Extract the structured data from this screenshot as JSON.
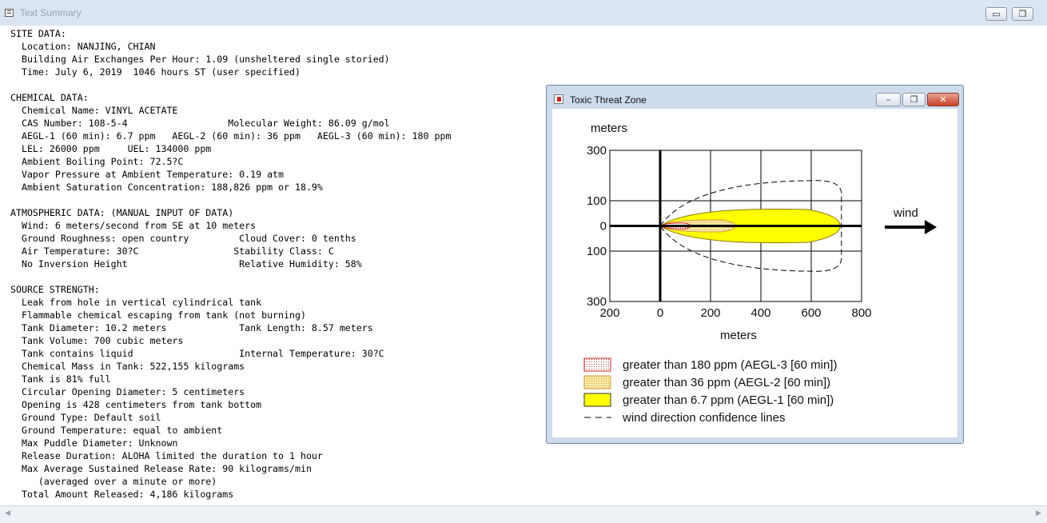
{
  "main_window": {
    "title": "Text Summary",
    "buttons": {
      "minimize": "▭",
      "restore": "❐"
    }
  },
  "summary_lines": [
    "SITE DATA:",
    "  Location: NANJING, CHIAN",
    "  Building Air Exchanges Per Hour: 1.09 (unsheltered single storied)",
    "  Time: July 6, 2019  1046 hours ST (user specified)",
    "",
    "CHEMICAL DATA:",
    "  Chemical Name: VINYL ACETATE",
    "  CAS Number: 108-5-4                  Molecular Weight: 86.09 g/mol",
    "  AEGL-1 (60 min): 6.7 ppm   AEGL-2 (60 min): 36 ppm   AEGL-3 (60 min): 180 ppm",
    "  LEL: 26000 ppm     UEL: 134000 ppm",
    "  Ambient Boiling Point: 72.5?C",
    "  Vapor Pressure at Ambient Temperature: 0.19 atm",
    "  Ambient Saturation Concentration: 188,826 ppm or 18.9%",
    "",
    "ATMOSPHERIC DATA: (MANUAL INPUT OF DATA)",
    "  Wind: 6 meters/second from SE at 10 meters",
    "  Ground Roughness: open country         Cloud Cover: 0 tenths",
    "  Air Temperature: 30?C                 Stability Class: C",
    "  No Inversion Height                    Relative Humidity: 58%",
    "",
    "SOURCE STRENGTH:",
    "  Leak from hole in vertical cylindrical tank",
    "  Flammable chemical escaping from tank (not burning)",
    "  Tank Diameter: 10.2 meters             Tank Length: 8.57 meters",
    "  Tank Volume: 700 cubic meters",
    "  Tank contains liquid                   Internal Temperature: 30?C",
    "  Chemical Mass in Tank: 522,155 kilograms",
    "  Tank is 81% full",
    "  Circular Opening Diameter: 5 centimeters",
    "  Opening is 428 centimeters from tank bottom",
    "  Ground Type: Default soil",
    "  Ground Temperature: equal to ambient",
    "  Max Puddle Diameter: Unknown",
    "  Release Duration: ALOHA limited the duration to 1 hour",
    "  Max Average Sustained Release Rate: 90 kilograms/min",
    "     (averaged over a minute or more)",
    "  Total Amount Released: 4,186 kilograms"
  ],
  "threat_window": {
    "title": "Toxic Threat Zone",
    "buttons": {
      "minimize": "–",
      "restore": "❐",
      "close": "✕"
    },
    "y_unit_label": "meters",
    "x_unit_label": "meters",
    "wind_label": "wind",
    "legend": [
      {
        "label": "greater than 180 ppm (AEGL-3 [60 min])",
        "color": "#ffffff",
        "pattern": "red-dots"
      },
      {
        "label": "greater than 36 ppm (AEGL-2 [60 min])",
        "color": "#f7e8a0",
        "pattern": "orange-dots"
      },
      {
        "label": "greater than 6.7 ppm (AEGL-1 [60 min])",
        "color": "#ffff00",
        "pattern": "solid"
      },
      {
        "label": "wind direction confidence lines",
        "color": "#000000",
        "pattern": "dashed"
      }
    ]
  },
  "chart_data": {
    "type": "area",
    "x_ticks": [
      "200",
      "0",
      "200",
      "400",
      "600",
      "800"
    ],
    "y_ticks": [
      "300",
      "100",
      "0",
      "100",
      "300"
    ],
    "xlim": [
      -200,
      800
    ],
    "ylim": [
      -300,
      300
    ],
    "grid": true,
    "zones": [
      {
        "name": "greater than 6.7 ppm (AEGL-1 [60 min])",
        "color": "#ffff00",
        "max_x": 715,
        "half_width": 70
      },
      {
        "name": "greater than 36 ppm (AEGL-2 [60 min])",
        "color": "#f7e8a0",
        "max_x": 300,
        "half_width": 25
      },
      {
        "name": "greater than 180 ppm (AEGL-3 [60 min])",
        "color": "#ffffff",
        "max_x": 120,
        "half_width": 12
      }
    ],
    "confidence_lines": {
      "max_x": 720,
      "half_width": 180
    }
  }
}
